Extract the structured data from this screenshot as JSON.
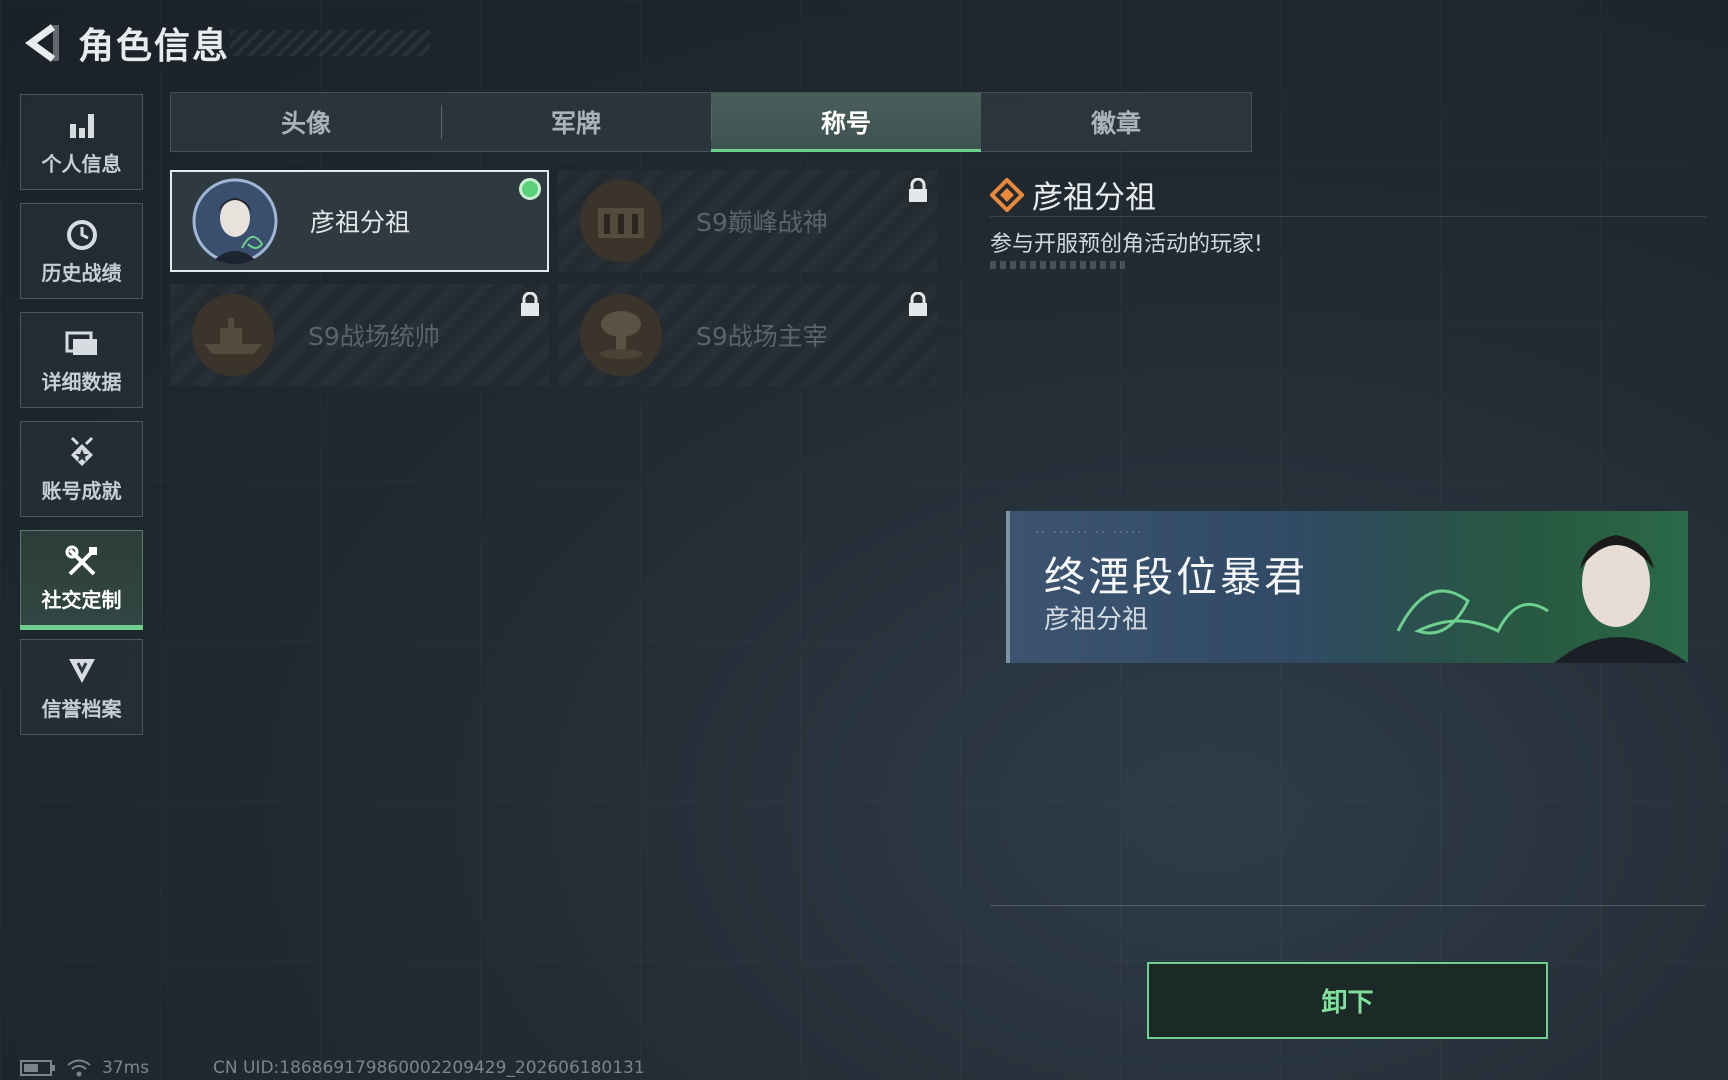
{
  "header": {
    "title": "角色信息"
  },
  "sidebar": {
    "items": [
      {
        "label": "个人信息",
        "icon": "bar-chart-icon"
      },
      {
        "label": "历史战绩",
        "icon": "history-clock-icon"
      },
      {
        "label": "详细数据",
        "icon": "folder-icon"
      },
      {
        "label": "账号成就",
        "icon": "medal-icon"
      },
      {
        "label": "社交定制",
        "icon": "tools-icon",
        "active": true
      },
      {
        "label": "信誉档案",
        "icon": "shield-badge-icon"
      }
    ]
  },
  "tabs": [
    {
      "label": "头像"
    },
    {
      "label": "军牌"
    },
    {
      "label": "称号",
      "active": true
    },
    {
      "label": "徽章"
    }
  ],
  "cards": [
    {
      "name": "彦祖分祖",
      "state": "equipped"
    },
    {
      "name": "S9巅峰战神",
      "state": "locked"
    },
    {
      "name": "S9战场统帅",
      "state": "locked"
    },
    {
      "name": "S9战场主宰",
      "state": "locked"
    }
  ],
  "detail": {
    "title": "彦祖分祖",
    "description": "参与开服预创角活动的玩家!"
  },
  "banner": {
    "title": "终湮段位暴君",
    "subtitle": "彦祖分祖"
  },
  "actions": {
    "unequip_label": "卸下"
  },
  "status": {
    "ping": "37ms",
    "uid": "CN UID:1868691798600022094​29_202606180131"
  },
  "colors": {
    "accent": "#6ed08f",
    "title_icon": "#e8883a"
  }
}
